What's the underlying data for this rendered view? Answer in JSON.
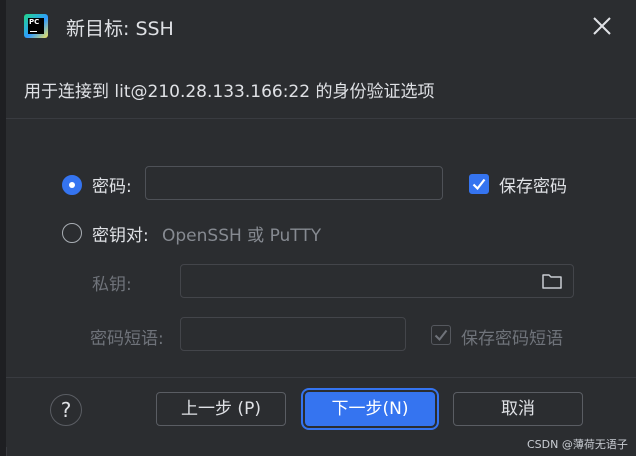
{
  "dialog": {
    "title": "新目标: SSH",
    "app_icon_text": "PC",
    "subtitle": "用于连接到 lit@210.28.133.166:22 的身份验证选项"
  },
  "password_option": {
    "label": "密码:",
    "selected": true,
    "value": "",
    "save_password_label": "保存密码",
    "save_password_checked": true
  },
  "keypair_option": {
    "label": "密钥对:",
    "hint": "OpenSSH 或 PuTTY",
    "selected": false,
    "private_key_label": "私钥:",
    "private_key_value": "",
    "passphrase_label": "密码短语:",
    "passphrase_value": "",
    "save_passphrase_label": "保存密码短语",
    "save_passphrase_checked": true
  },
  "footer": {
    "help_label": "?",
    "prev_label": "上一步 (P)",
    "next_label": "下一步(N)",
    "cancel_label": "取消"
  },
  "icons": {
    "close": "close-icon",
    "folder": "folder-icon",
    "check": "check-icon"
  },
  "watermark": "CSDN @薄荷无语子",
  "colors": {
    "accent": "#3574f0",
    "background": "#2b2d30",
    "text": "#dfe1e5"
  }
}
